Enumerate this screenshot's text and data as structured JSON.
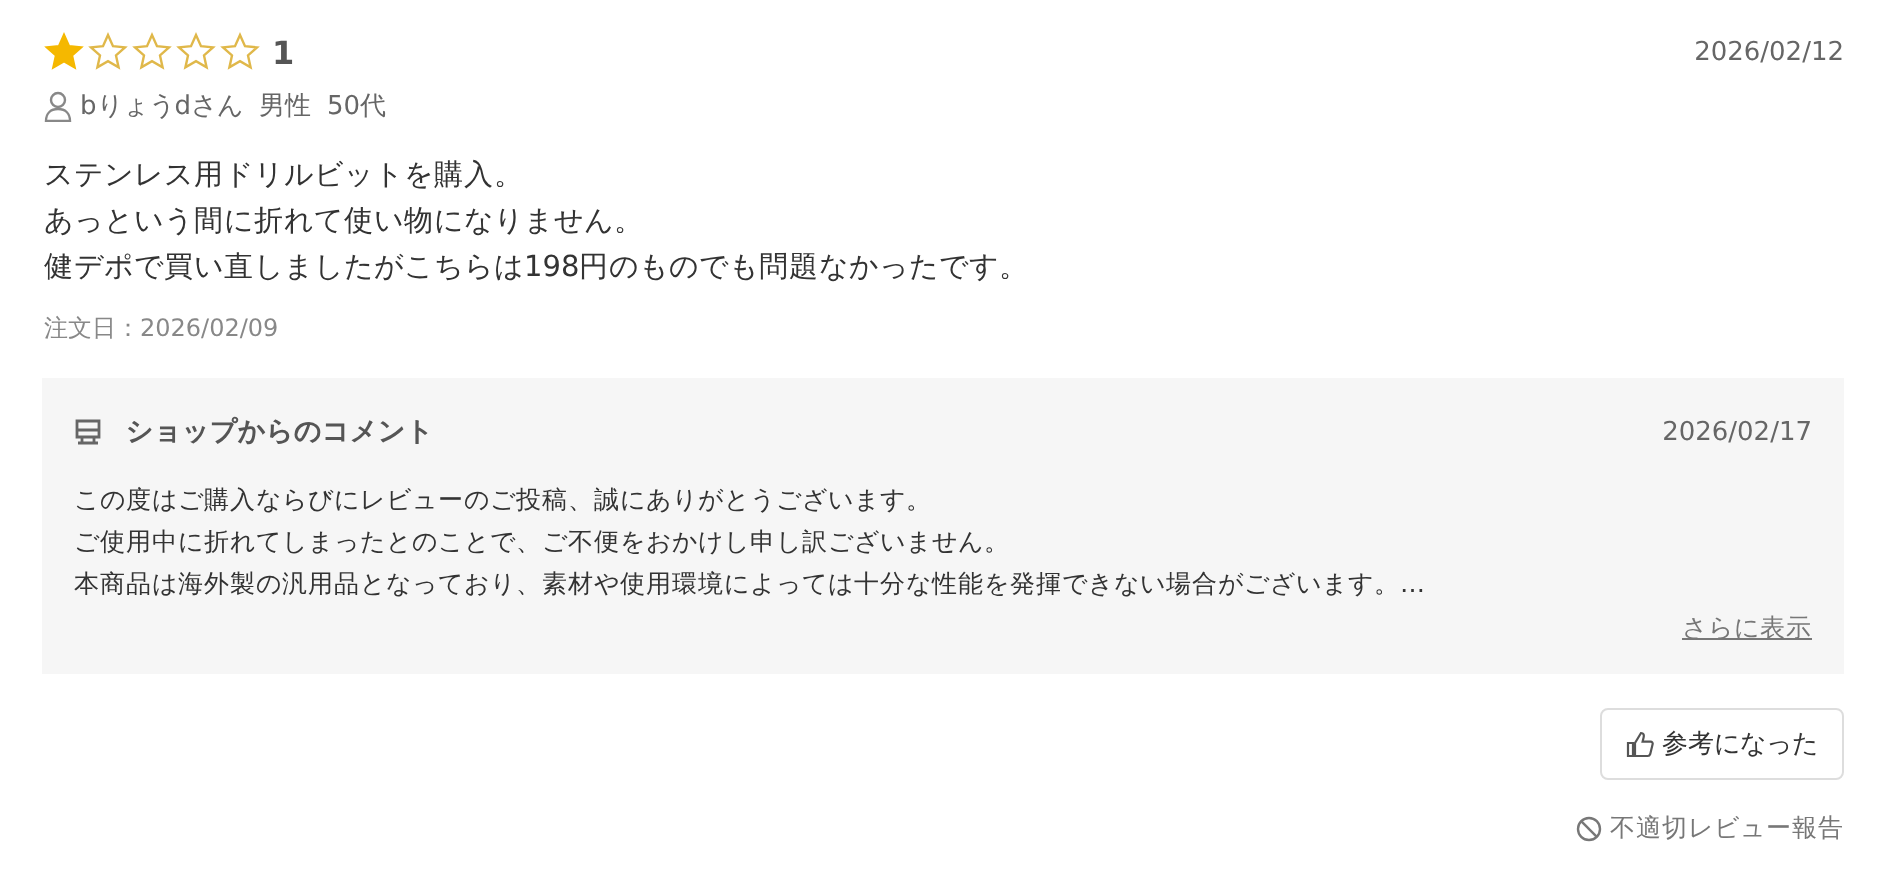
{
  "review": {
    "stars": 1,
    "rating": "1",
    "date": "2026/02/12",
    "reviewer": {
      "name": "bりょうdさん",
      "gender": "男性",
      "age": "50代"
    },
    "body_lines": [
      "ステンレス用ドリルビットを購入。",
      "あっという間に折れて使い物になりません。",
      "健デポで買い直しましたがこちらは198円のものでも問題なかったです。"
    ],
    "order_date": "注文日：2026/02/09"
  },
  "shop_comment": {
    "title": "ショップからのコメント",
    "date": "2026/02/17",
    "body_lines": [
      "この度はご購入ならびにレビューのご投稿、誠にありがとうございます。",
      "ご使用中に折れてしまったとのことで、ご不便をおかけし申し訳ございません。",
      "本商品は海外製の汎用品となっており、素材や使用環境によっては十分な性能を発揮できない場合がございます。…"
    ],
    "more_link": "さらに表示"
  },
  "helpful_button": "参考になった",
  "report_link": "不適切レビュー報告"
}
